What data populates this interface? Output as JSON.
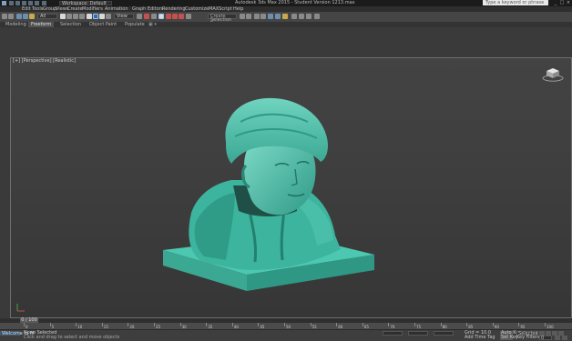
{
  "titlebar": {
    "workspace": "Workspace: Default",
    "title": "Autodesk 3ds Max 2015 - Student Version    1213.max",
    "search_placeholder": "Type a keyword or phrase"
  },
  "menu": {
    "items": [
      "Edit",
      "Tools",
      "Group",
      "Views",
      "Create",
      "Modifiers",
      "Animation",
      "Graph Editors",
      "Rendering",
      "Customize",
      "MAXScript",
      "Help"
    ]
  },
  "toolbar": {
    "selection_filter": "All",
    "ref_coord": "View",
    "named_sets": "Create Selection Se"
  },
  "ribbon": {
    "tabs": [
      "Modeling",
      "Freeform",
      "Selection",
      "Object Paint",
      "Populate"
    ],
    "active": "Freeform"
  },
  "viewport": {
    "label": "[+] [Perspective] [Realistic]",
    "accent_object": "#3fb59f",
    "background_top": "#434343"
  },
  "timeline": {
    "frame_display": "0 / 100",
    "ticks": [
      "0",
      "5",
      "10",
      "15",
      "20",
      "25",
      "30",
      "35",
      "40",
      "45",
      "50",
      "55",
      "60",
      "65",
      "70",
      "75",
      "80",
      "85",
      "90",
      "95",
      "100"
    ]
  },
  "status": {
    "selection": "None Selected",
    "prompt": "Click and drag to select and move objects",
    "auto_key": "Auto Key",
    "set_key": "Set Key",
    "key_filters": "Key Filters...",
    "selected_dropdown": "Selected",
    "frame_field": "0",
    "maxscript": "Welcome to M",
    "add_time_tag": "Add Time Tag",
    "grid": "Grid = 10.0"
  }
}
